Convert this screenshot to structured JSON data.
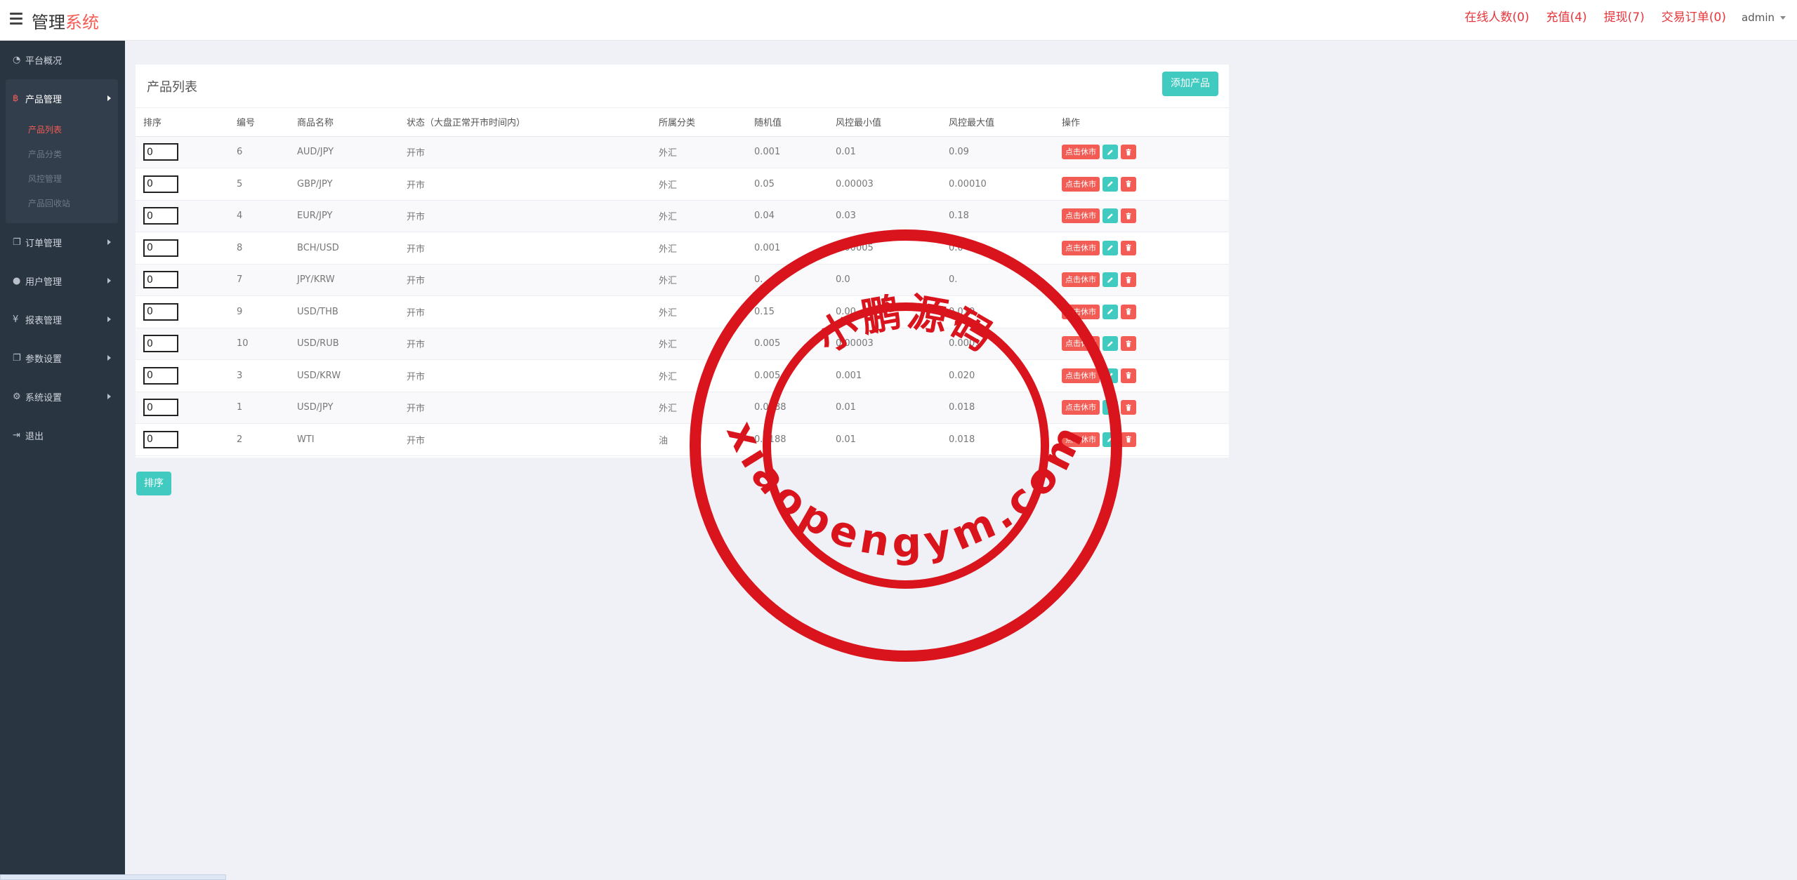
{
  "brand": {
    "main": "管理",
    "accent": "系统"
  },
  "topnav": [
    {
      "label": "在线人数(0)"
    },
    {
      "label": "充值(4)"
    },
    {
      "label": "提现(7)"
    },
    {
      "label": "交易订单(0)"
    }
  ],
  "user": {
    "name": "admin"
  },
  "sidebar": {
    "items": [
      {
        "label": "平台概况",
        "icon": "dashboard-icon"
      },
      {
        "label": "产品管理",
        "icon": "bitcoin-icon"
      },
      {
        "label": "订单管理",
        "icon": "copy-icon"
      },
      {
        "label": "用户管理",
        "icon": "user-icon"
      },
      {
        "label": "报表管理",
        "icon": "yen-icon"
      },
      {
        "label": "参数设置",
        "icon": "copy-icon"
      },
      {
        "label": "系统设置",
        "icon": "cogs-icon"
      },
      {
        "label": "退出",
        "icon": "sign-out-icon"
      }
    ],
    "subitems": [
      {
        "label": "产品列表"
      },
      {
        "label": "产品分类"
      },
      {
        "label": "风控管理"
      },
      {
        "label": "产品回收站"
      }
    ]
  },
  "panel": {
    "title": "产品列表",
    "add_label": "添加产品",
    "columns": [
      "排序",
      "编号",
      "商品名称",
      "状态（大盘正常开市时间内）",
      "所属分类",
      "随机值",
      "风控最小值",
      "风控最大值",
      "操作"
    ],
    "halt_label": "点击休市",
    "rows": [
      {
        "sort": "0",
        "id": "6",
        "name": "AUD/JPY",
        "status": "开市",
        "category": "外汇",
        "random": "0.001",
        "min": "0.01",
        "max": "0.09"
      },
      {
        "sort": "0",
        "id": "5",
        "name": "GBP/JPY",
        "status": "开市",
        "category": "外汇",
        "random": "0.05",
        "min": "0.00003",
        "max": "0.00010"
      },
      {
        "sort": "0",
        "id": "4",
        "name": "EUR/JPY",
        "status": "开市",
        "category": "外汇",
        "random": "0.04",
        "min": "0.03",
        "max": "0.18"
      },
      {
        "sort": "0",
        "id": "8",
        "name": "BCH/USD",
        "status": "开市",
        "category": "外汇",
        "random": "0.001",
        "min": "0.00005",
        "max": "0.0"
      },
      {
        "sort": "0",
        "id": "7",
        "name": "JPY/KRW",
        "status": "开市",
        "category": "外汇",
        "random": "0.",
        "min": "0.0",
        "max": "0."
      },
      {
        "sort": "0",
        "id": "9",
        "name": "USD/THB",
        "status": "开市",
        "category": "外汇",
        "random": "0.15",
        "min": "0.00",
        "max": "0.010"
      },
      {
        "sort": "0",
        "id": "10",
        "name": "USD/RUB",
        "status": "开市",
        "category": "外汇",
        "random": "0.005",
        "min": "0.00003",
        "max": "0.0001"
      },
      {
        "sort": "0",
        "id": "3",
        "name": "USD/KRW",
        "status": "开市",
        "category": "外汇",
        "random": "0.005",
        "min": "0.001",
        "max": "0.020"
      },
      {
        "sort": "0",
        "id": "1",
        "name": "USD/JPY",
        "status": "开市",
        "category": "外汇",
        "random": "0.0188",
        "min": "0.01",
        "max": "0.018"
      },
      {
        "sort": "0",
        "id": "2",
        "name": "WTI",
        "status": "开市",
        "category": "油",
        "random": "0.0188",
        "min": "0.01",
        "max": "0.018"
      }
    ]
  },
  "sort_button": "排序",
  "watermark": {
    "top_text": "小鹏源码",
    "bottom_text": "xiaopengym.com",
    "color": "#d9141c"
  }
}
